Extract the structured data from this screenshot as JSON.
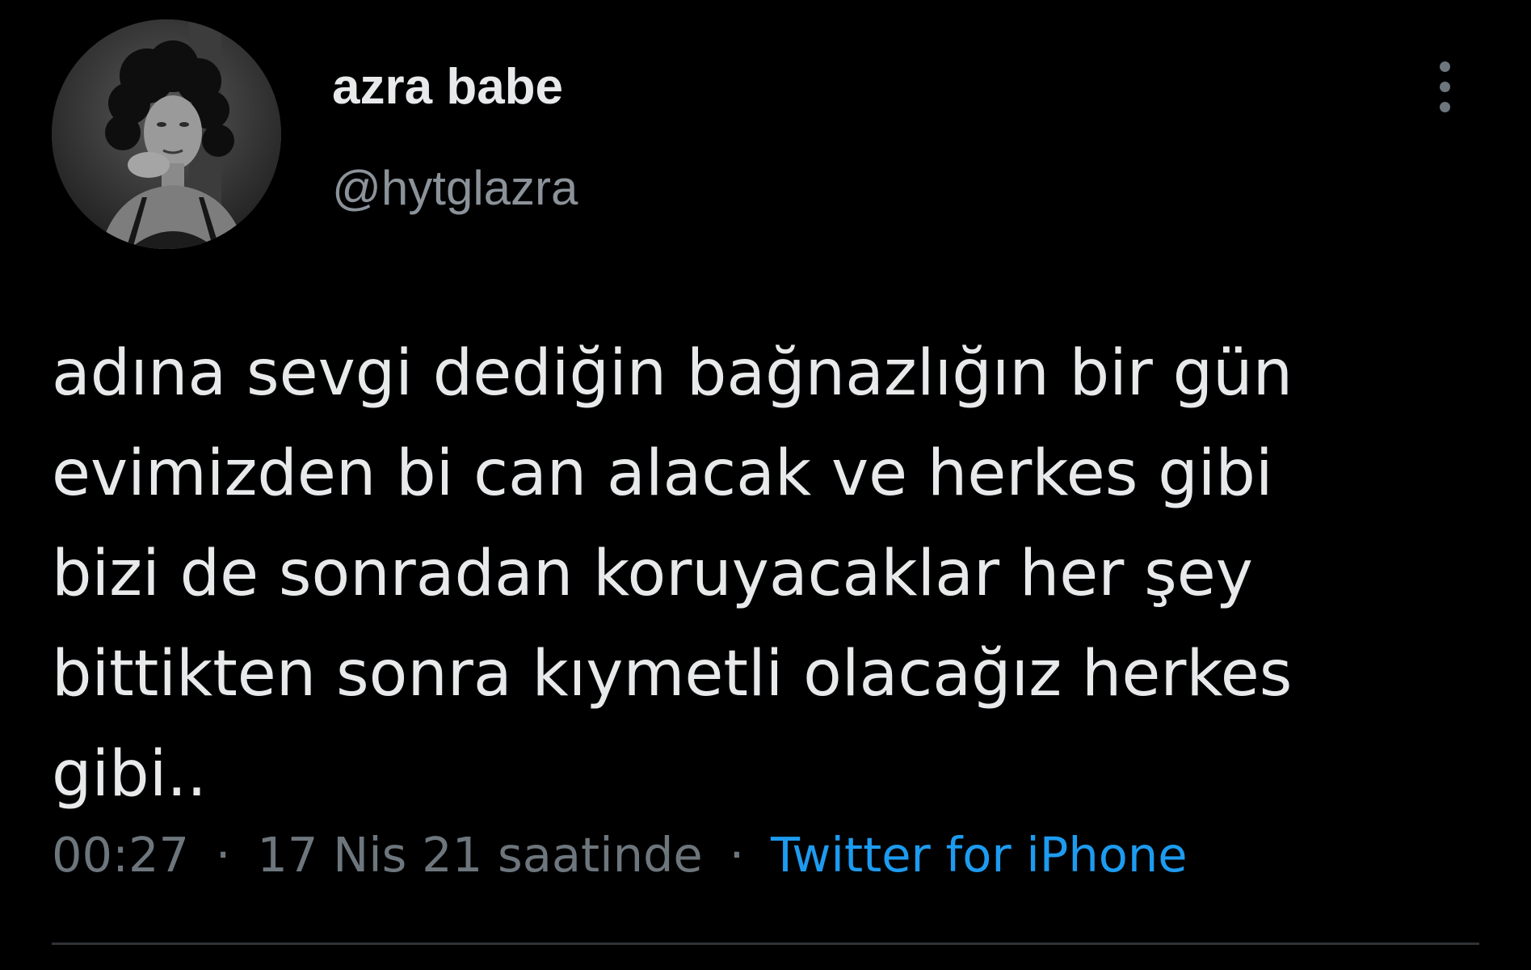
{
  "tweet": {
    "display_name": "azra babe",
    "handle": "@hytglazra",
    "text": "adına sevgi dediğin bağnazlığın bir gün\nevimizden bi can alacak ve herkes gibi\nbizi de sonradan koruyacaklar her şey\nbittikten sonra kıymetli olacağız herkes\ngibi..",
    "time": "00:27",
    "separator": "·",
    "date": "17 Nis 21 saatinde",
    "source": "Twitter for iPhone",
    "menu_icon": "more-vertical-icon",
    "avatar_icon": "profile-photo"
  },
  "colors": {
    "background": "#000000",
    "text_primary": "#e7e9ea",
    "text_secondary": "#6e767d",
    "link": "#1d9bf0",
    "divider": "#2f3336"
  }
}
